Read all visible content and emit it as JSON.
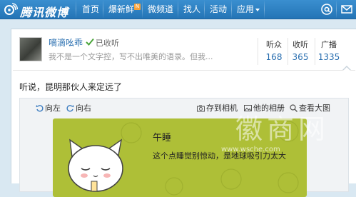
{
  "app": {
    "logo_text": "腾讯微博",
    "colors": {
      "nav_bg": "#2b7dc2",
      "link": "#2a6fb0",
      "image_bg": "#aebf37",
      "badge": "#f7a23a"
    }
  },
  "nav": {
    "items": [
      {
        "label": "首页"
      },
      {
        "label": "爆新鲜",
        "badge": "N"
      },
      {
        "label": "微频道"
      },
      {
        "label": "找人"
      },
      {
        "label": "活动"
      },
      {
        "label": "应用"
      }
    ],
    "right_icons": [
      "mention-icon",
      "mail-icon"
    ]
  },
  "profile": {
    "name": "嘀滴吆乖",
    "status": "已收听",
    "bio": "我不是一个文字控，写不出唯美的语录。但我...",
    "stats": [
      {
        "label": "听众",
        "value": "168"
      },
      {
        "label": "收听",
        "value": "365"
      },
      {
        "label": "广播",
        "value": "1335"
      }
    ]
  },
  "post": {
    "text": "听说，昆明那伙人来定远了",
    "tools": {
      "rotate_left": "向左",
      "rotate_right": "向右",
      "save": "存到相机",
      "album": "他的相册",
      "view_large": "查看大图"
    },
    "image": {
      "title": "午睡",
      "caption": "这个点睡觉别惊动，是地球吸引力太大"
    }
  },
  "watermark": {
    "brand": "徽商网",
    "url": "www.wsche.com"
  }
}
